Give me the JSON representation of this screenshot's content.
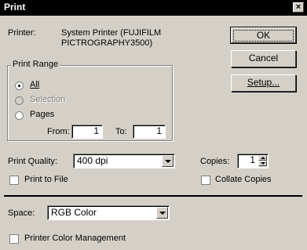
{
  "window": {
    "title": "Print",
    "close_glyph": "×"
  },
  "printer": {
    "label": "Printer:",
    "name_line1": "System Printer (FUJIFILM",
    "name_line2": "PICTROGRAPHY3500)"
  },
  "buttons": {
    "ok": "OK",
    "cancel": "Cancel",
    "setup": "Setup..."
  },
  "print_range": {
    "legend": "Print Range",
    "all": "All",
    "selection": "Selection",
    "pages": "Pages",
    "selected": "all",
    "from_label": "From:",
    "from_value": "1",
    "to_label": "To:",
    "to_value": "1"
  },
  "print_quality": {
    "label": "Print Quality:",
    "value": "400 dpi"
  },
  "copies": {
    "label": "Copies:",
    "value": "1"
  },
  "checkboxes": {
    "print_to_file": "Print to File",
    "collate_copies": "Collate Copies",
    "printer_color_management": "Printer Color Management"
  },
  "space": {
    "label": "Space:",
    "value": "RGB Color"
  }
}
